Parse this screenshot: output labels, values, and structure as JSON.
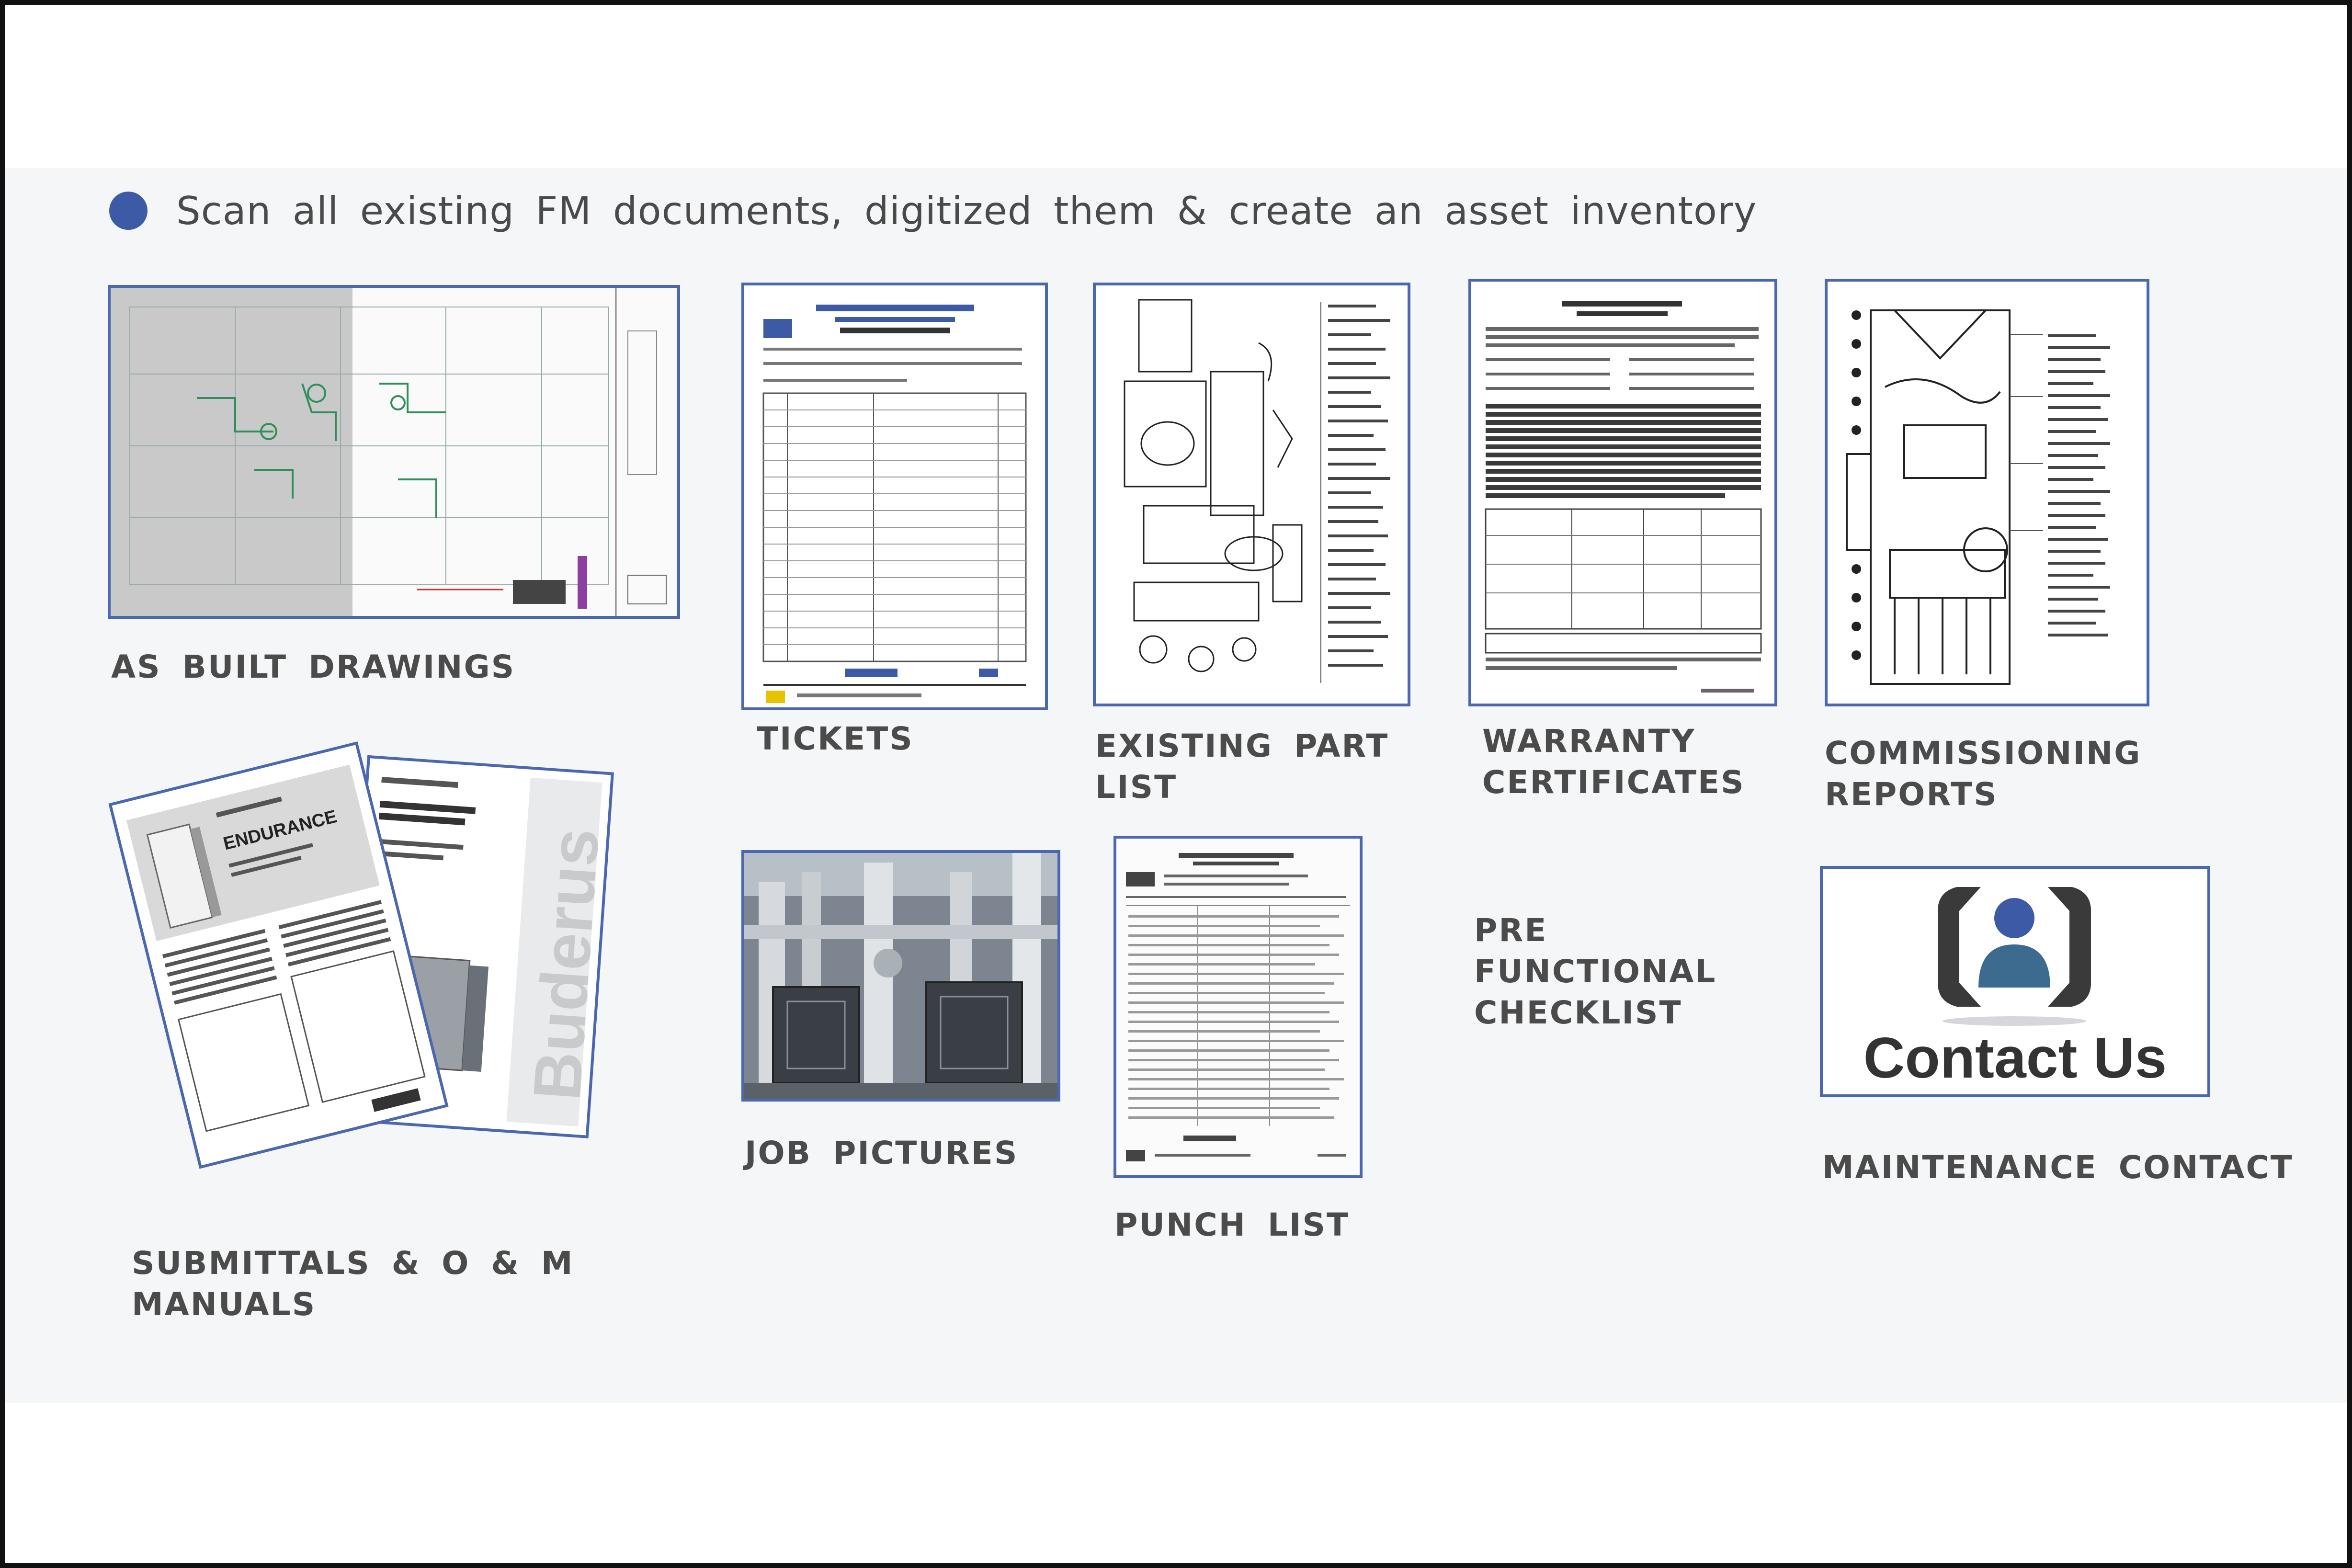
{
  "colors": {
    "accent_blue": "#4a67b0",
    "bullet_blue": "#3c5aa6",
    "label_gray": "#4b4b4b",
    "panel_bg": "#f5f6f8"
  },
  "header": {
    "bullet_text": "Scan all existing FM documents, digitized them & create an asset inventory"
  },
  "items": {
    "as_built": {
      "label": "AS BUILT DRAWINGS"
    },
    "tickets": {
      "label": "TICKETS"
    },
    "part_list": {
      "label": "EXISTING PART\nLIST"
    },
    "warranty": {
      "label": "WARRANTY\nCERTIFICATES"
    },
    "commissioning": {
      "label": "COMMISSIONING\nREPORTS"
    },
    "submittals": {
      "label": "SUBMITTALS & O & M\nMANUALS",
      "manual_brand": "Buderus",
      "manual_title": "ENDURANCE"
    },
    "job_pictures": {
      "label": "JOB PICTURES"
    },
    "punch_list": {
      "label": "PUNCH LIST"
    },
    "pre_functional": {
      "label": "PRE\nFUNCTIONAL\nCHECKLIST"
    },
    "maintenance": {
      "label": "MAINTENANCE CONTACT",
      "button_text": "Contact Us",
      "icon": "contact-person-icon"
    }
  }
}
